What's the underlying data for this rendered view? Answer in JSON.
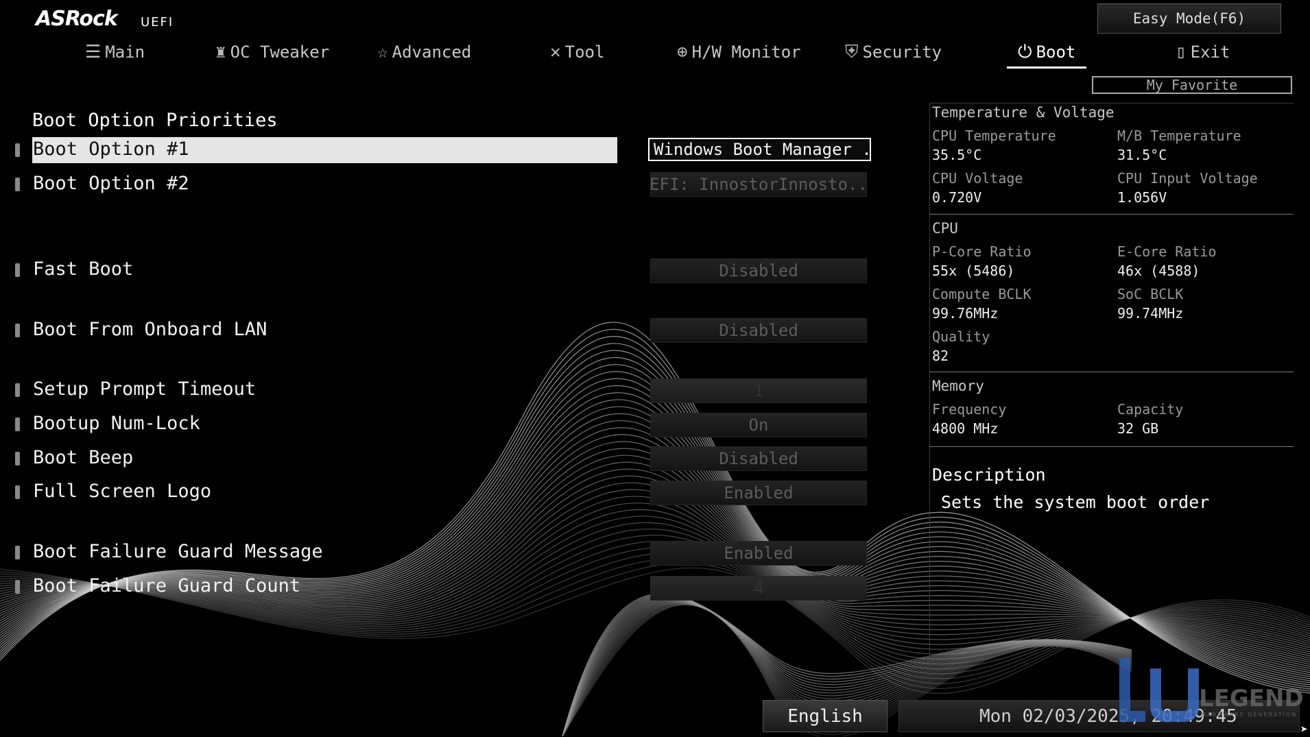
{
  "header": {
    "brand": "ASRock",
    "brand_sub": "UEFI",
    "easy_mode_label": "Easy Mode(F6)",
    "my_favorite_label": "My Favorite",
    "tabs": [
      {
        "label": "Main",
        "icon": "list-icon"
      },
      {
        "label": "OC Tweaker",
        "icon": "rocket-icon"
      },
      {
        "label": "Advanced",
        "icon": "star-icon"
      },
      {
        "label": "Tool",
        "icon": "tools-icon"
      },
      {
        "label": "H/W Monitor",
        "icon": "crosshair-icon"
      },
      {
        "label": "Security",
        "icon": "shield-icon"
      },
      {
        "label": "Boot",
        "icon": "power-icon",
        "active": true
      },
      {
        "label": "Exit",
        "icon": "exit-door-icon"
      }
    ]
  },
  "boot": {
    "section_title": "Boot Option Priorities",
    "options": [
      {
        "label": "Boot Option #1",
        "value": "Windows Boot Manager ..."
      },
      {
        "label": "Boot Option #2",
        "value": "UEFI: InnostorInnosto..."
      },
      {
        "label": "Fast Boot",
        "value": "Disabled"
      },
      {
        "label": "Boot From Onboard LAN",
        "value": "Disabled"
      },
      {
        "label": "Setup Prompt Timeout",
        "value": "1"
      },
      {
        "label": "Bootup Num-Lock",
        "value": "On"
      },
      {
        "label": "Boot Beep",
        "value": "Disabled"
      },
      {
        "label": "Full Screen Logo",
        "value": "Enabled"
      },
      {
        "label": "Boot Failure Guard Message",
        "value": "Enabled"
      },
      {
        "label": "Boot Failure Guard Count",
        "value": "4"
      }
    ]
  },
  "monitor": {
    "temp_voltage_title": "Temperature & Voltage",
    "cpu_temp_label": "CPU Temperature",
    "cpu_temp_value": "35.5°C",
    "mb_temp_label": "M/B Temperature",
    "mb_temp_value": "31.5°C",
    "cpu_voltage_label": "CPU Voltage",
    "cpu_voltage_value": "0.720V",
    "cpu_input_voltage_label": "CPU Input Voltage",
    "cpu_input_voltage_value": "1.056V",
    "cpu_title": "CPU",
    "pcore_label": "P-Core Ratio",
    "pcore_value": "55x (5486)",
    "ecore_label": "E-Core Ratio",
    "ecore_value": "46x (4588)",
    "bclk_label": "Compute BCLK",
    "bclk_value": "99.76MHz",
    "soc_label": "SoC BCLK",
    "soc_value": "99.74MHz",
    "quality_label": "Quality",
    "quality_value": "82",
    "memory_title": "Memory",
    "freq_label": "Frequency",
    "freq_value": "4800 MHz",
    "cap_label": "Capacity",
    "cap_value": "32 GB"
  },
  "description": {
    "title": "Description",
    "text": "Sets the system boot order"
  },
  "footer": {
    "language": "English",
    "datetime": "Mon 02/03/2025, 20:49:45",
    "watermark_text": "LEGEND",
    "watermark_sub": "HARDWARE GENERATION"
  }
}
